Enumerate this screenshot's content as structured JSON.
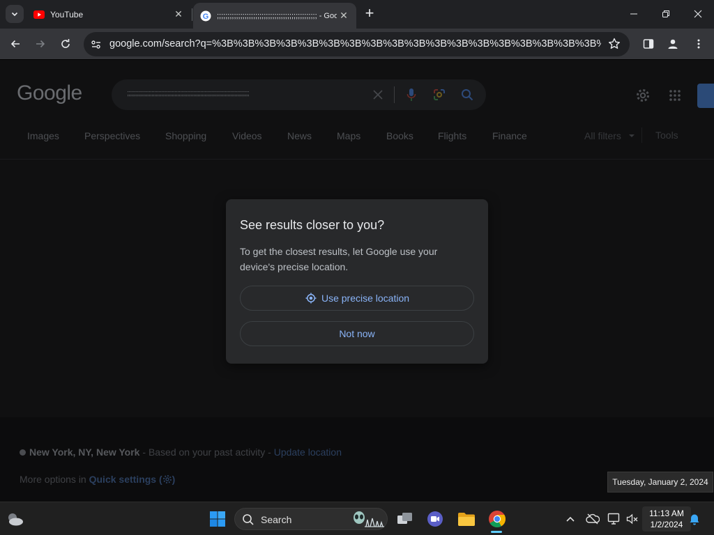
{
  "browser": {
    "tabs": [
      {
        "title": "YouTube",
        "active": false
      },
      {
        "title": ";;;;;;;;;;;;;;;;;;;;;;;;;;;;;;;;;;;;;;;;;;;;;;; - Goo",
        "active": true
      }
    ],
    "address": "google.com/search?q=%3B%3B%3B%3B%3B%3B%3B%3B%3B%3B%3B%3B%3B%3B%3B%3B%3B%3B%3B%3B%3B%3B%3B%..."
  },
  "google": {
    "logo": "Google",
    "query": ";;;;;;;;;;;;;;;;;;;;;;;;;;;;;;;;;;;;;;;;;;;;;;;;;;;;;;;;;;;;;;;;;;;;;;;;;;;;;;;;;;;;;",
    "nav": [
      "Images",
      "Perspectives",
      "Shopping",
      "Videos",
      "News",
      "Maps",
      "Books",
      "Flights",
      "Finance"
    ],
    "all_filters": "All filters",
    "tools": "Tools",
    "footer": {
      "location": "New York, NY, New York",
      "sep1": " - ",
      "based_on": "Based on your past activity",
      "sep2": " - ",
      "update": "Update location",
      "more_prefix": "More options in ",
      "quick_settings": "Quick settings",
      "quick_paren_open": " (",
      "quick_paren_close": ")"
    }
  },
  "dialog": {
    "title": "See results closer to you?",
    "body": "To get the closest results, let Google use your device's precise location.",
    "primary": "Use precise location",
    "secondary": "Not now"
  },
  "tooltip": "Tuesday, January 2, 2024",
  "taskbar": {
    "search_label": "Search",
    "time": "11:13 AM",
    "date": "1/2/2024"
  },
  "colors": {
    "accent_blue": "#8ab4f8",
    "youtube_red": "#ff0000",
    "chrome_active_indicator": "#60cdff"
  }
}
